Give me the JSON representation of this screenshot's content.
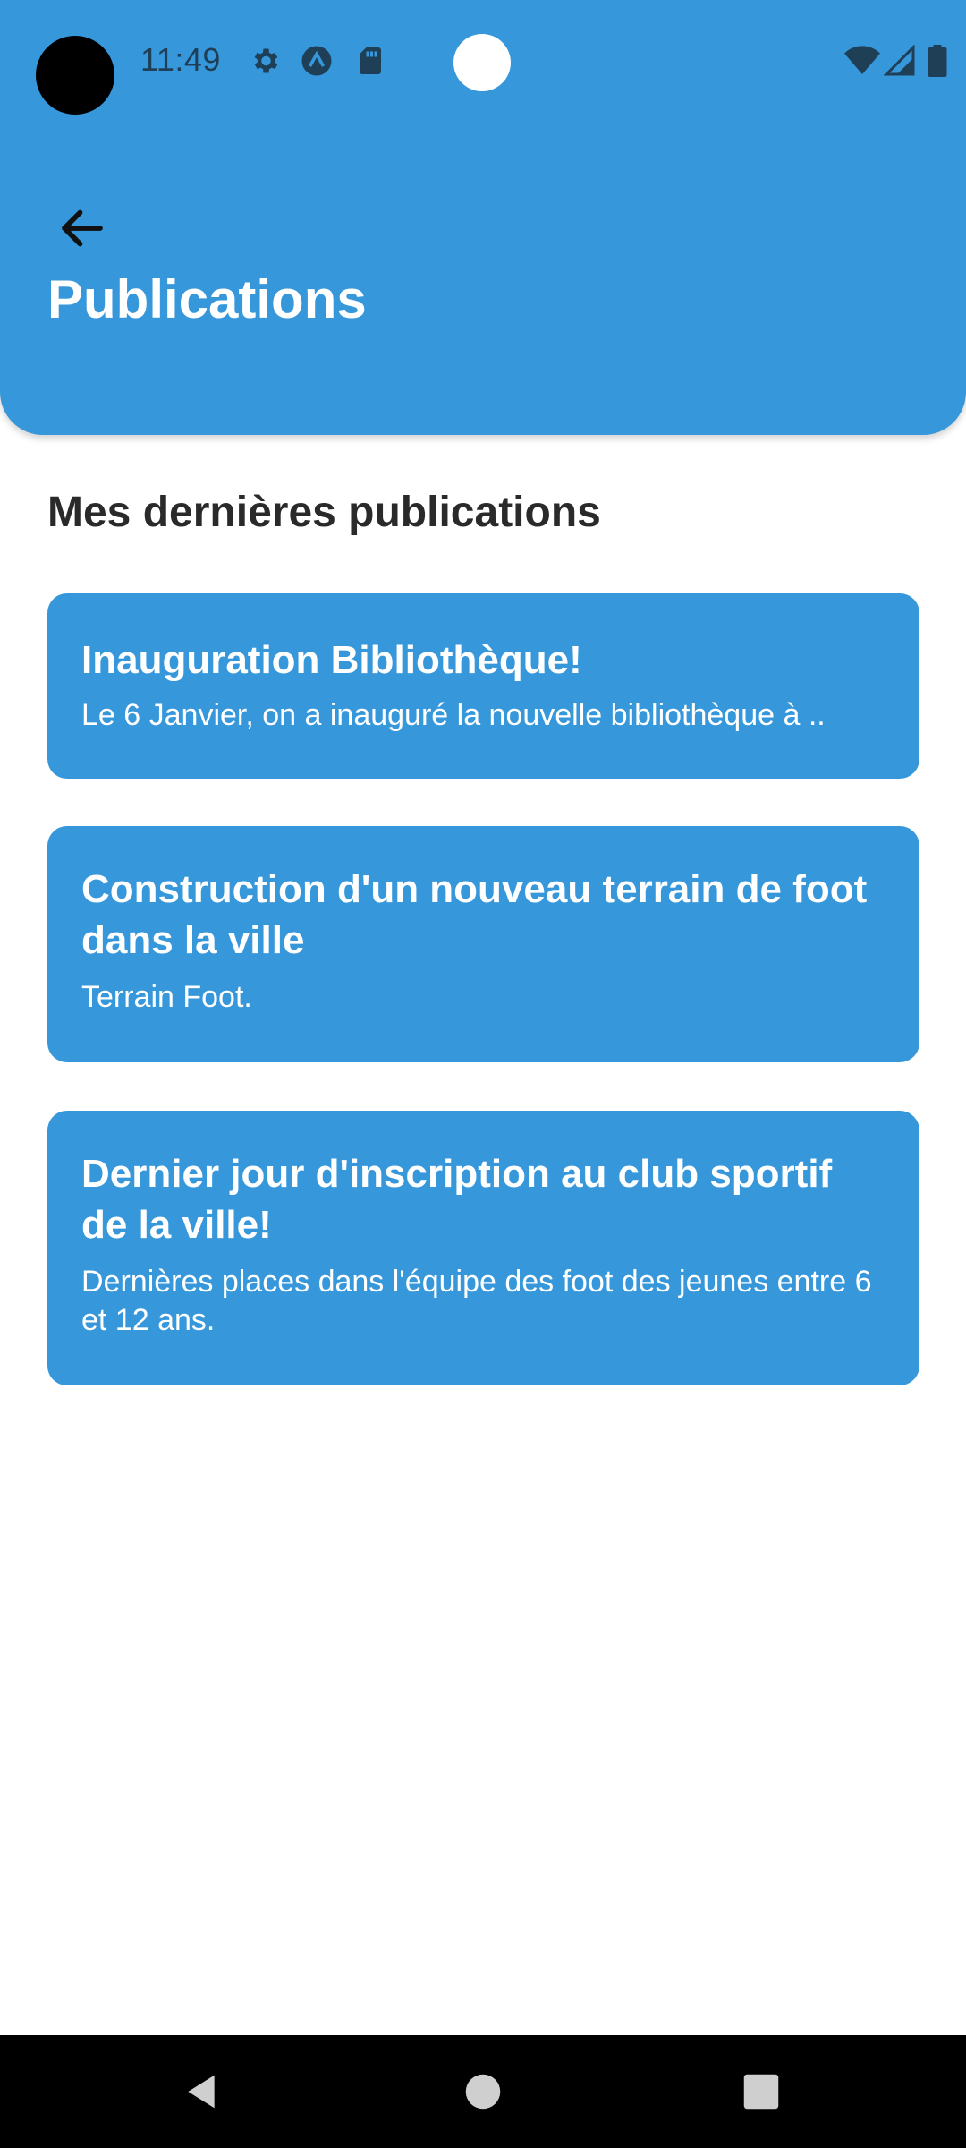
{
  "status_bar": {
    "time": "11:49",
    "left_icons": [
      "settings-icon",
      "a-logo-icon",
      "sd-card-icon"
    ],
    "right_icons": [
      "wifi-icon",
      "signal-icon",
      "battery-icon"
    ]
  },
  "header": {
    "back_icon": "arrow-left-icon",
    "title": "Publications",
    "background": "#3697db"
  },
  "section": {
    "title": "Mes dernières publications"
  },
  "publications": [
    {
      "title": "Inauguration Bibliothèque!",
      "excerpt": "Le 6 Janvier, on a inauguré la nouvelle bibliothèque à .."
    },
    {
      "title": "Construction d'un nouveau terrain de foot dans la ville",
      "excerpt": "Terrain Foot."
    },
    {
      "title": "Dernier jour d'inscription au club sportif de la ville!",
      "excerpt": "Dernières places dans l'équipe des foot des jeunes entre 6 et 12 ans."
    }
  ],
  "nav_bar": {
    "buttons": [
      "back-triangle-icon",
      "home-circle-icon",
      "recents-square-icon"
    ]
  }
}
